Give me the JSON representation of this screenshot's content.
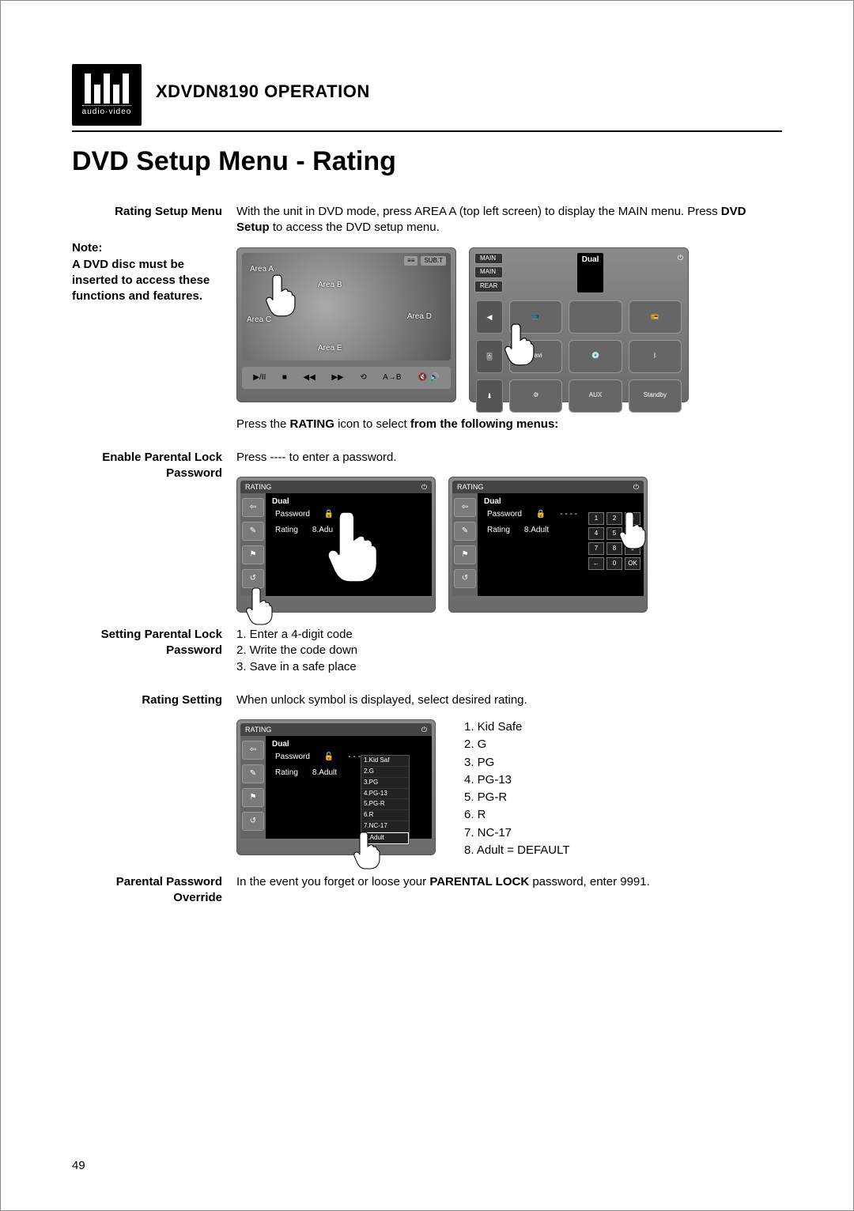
{
  "brand": {
    "name": "Dual",
    "sub": "audio·video"
  },
  "header": {
    "model": "XDVDN8190",
    "word": "OPERATION"
  },
  "section_title": "DVD Setup Menu - Rating",
  "labels": {
    "rating_setup_menu": "Rating Setup Menu",
    "note_heading": "Note:",
    "note_body": "A DVD disc must be inserted to access these functions and features.",
    "enable_lock": "Enable Parental Lock Password",
    "setting_lock": "Setting Parental Lock Password",
    "rating_setting": "Rating Setting",
    "override": "Parental Password Override"
  },
  "body": {
    "intro_1": "With the unit in DVD mode, press AREA A (top left screen) to display the MAIN menu. Press ",
    "intro_bold1": "DVD Setup",
    "intro_2": " to access the DVD setup menu.",
    "press_rating_1": "Press the ",
    "press_rating_bold": "RATING",
    "press_rating_2": " icon to select ",
    "press_rating_bold2": "from the following menus:",
    "enter_password": "Press ---- to enter a password.",
    "steps": [
      "1. Enter a 4-digit code",
      "2. Write the code down",
      "3. Save in a safe place"
    ],
    "unlock_text": "When unlock symbol is displayed, select desired rating.",
    "ratings": [
      "1. Kid Safe",
      "2. G",
      "3. PG",
      "4. PG-13",
      "5. PG-R",
      "6. R",
      "7. NC-17",
      "8. Adult = DEFAULT"
    ],
    "override_1": "In the event you forget or loose your ",
    "override_bold": "PARENTAL LOCK",
    "override_2": " password, enter 9991."
  },
  "screens": {
    "areas": {
      "a": "Area A",
      "b": "Area B",
      "c": "Area C",
      "d": "Area D",
      "e": "Area E",
      "subt": "SUB.T"
    },
    "transport": [
      "▶/II",
      "■",
      "◀◀",
      "▶▶",
      "⟲",
      "A→B",
      "🔇 🔊"
    ],
    "main_menu": {
      "tags": [
        "MAIN",
        "MAIN",
        "REAR"
      ],
      "nav": "Navi",
      "standby": "Standby"
    },
    "rating_panel": {
      "title": "RATING",
      "brand": "Dual",
      "password_label": "Password",
      "rating_label": "Rating",
      "rating_value": "8.Adult",
      "password_dashes": "- - - -",
      "keypad": [
        "1",
        "2",
        "3",
        "4",
        "5",
        "6",
        "7",
        "8",
        "9",
        "←",
        "0",
        "OK"
      ],
      "dropdown": [
        "1.Kid Saf",
        "2.G",
        "3.PG",
        "4.PG-13",
        "5.PG-R",
        "6.R",
        "7.NC-17",
        "8.Adult"
      ]
    }
  },
  "page_number": "49"
}
